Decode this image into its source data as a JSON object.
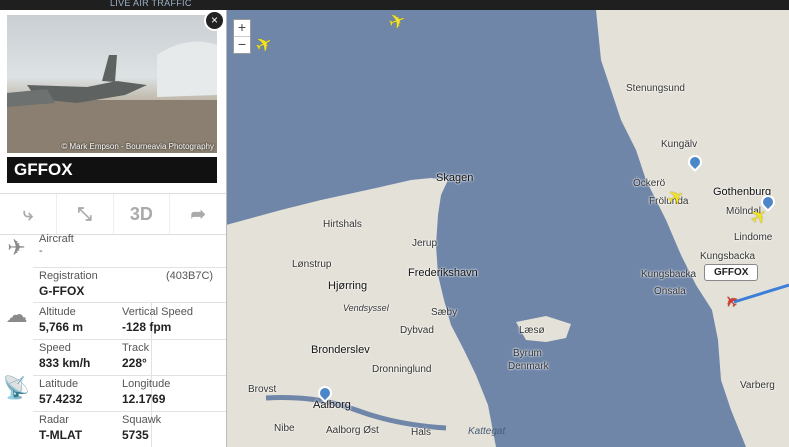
{
  "topbar": {
    "brand": "LIVE AIR TRAFFIC"
  },
  "map": {
    "zoom_in": "+",
    "zoom_out": "−",
    "places": {
      "skagen": "Skagen",
      "hirtshals": "Hirtshals",
      "jerup": "Jerup",
      "lonstrup": "Lønstrup",
      "frederikshavn": "Frederikshavn",
      "hjorring": "Hjørring",
      "vendsyssel": "Vendsyssel",
      "saeby": "Sæby",
      "dybvad": "Dybvad",
      "laeso": "Læsø",
      "byrum": "Byrum",
      "denmark": "Denmark",
      "bronderslev": "Bronderslev",
      "dronninglund": "Dronninglund",
      "brovst": "Brovst",
      "aalborg": "Aalborg",
      "nibe": "Nibe",
      "aalborg_ost": "Aalborg Øst",
      "hals": "Hals",
      "kattegat": "Kattegat",
      "stenungsund": "Stenungsund",
      "kungalv": "Kungälv",
      "ockero": "Öckerö",
      "gothenburg": "Gothenburg",
      "frolunda": "Frölunda",
      "molndal": "Mölndal",
      "lindome": "Lindome",
      "kungsbacka": "Kungsbacka",
      "kungsbacka2": "Kungsbacka",
      "onsala": "Onsala",
      "varberg": "Varberg"
    },
    "flight_tag": "GFFOX",
    "plane_icon": "✈"
  },
  "panel": {
    "close": "×",
    "photo_credit": "© Mark Empson - Bourneavia Photography",
    "callsign": "GFFOX",
    "tools": {
      "route": "⤷",
      "fit": "⤡",
      "view3d": "3D",
      "share": "➦"
    },
    "aircraft": {
      "label": "Aircraft",
      "value": "-"
    },
    "registration": {
      "label": "Registration",
      "value": "G-FFOX",
      "hex": "(403B7C)"
    },
    "altitude": {
      "label": "Altitude",
      "value": "5,766 m"
    },
    "vspeed": {
      "label": "Vertical Speed",
      "value": "-128 fpm"
    },
    "speed": {
      "label": "Speed",
      "value": "833 km/h"
    },
    "track": {
      "label": "Track",
      "value": "228°"
    },
    "latitude": {
      "label": "Latitude",
      "value": "57.4232"
    },
    "longitude": {
      "label": "Longitude",
      "value": "12.1769"
    },
    "radar": {
      "label": "Radar",
      "value": "T-MLAT"
    },
    "squawk": {
      "label": "Squawk",
      "value": "5735"
    }
  }
}
